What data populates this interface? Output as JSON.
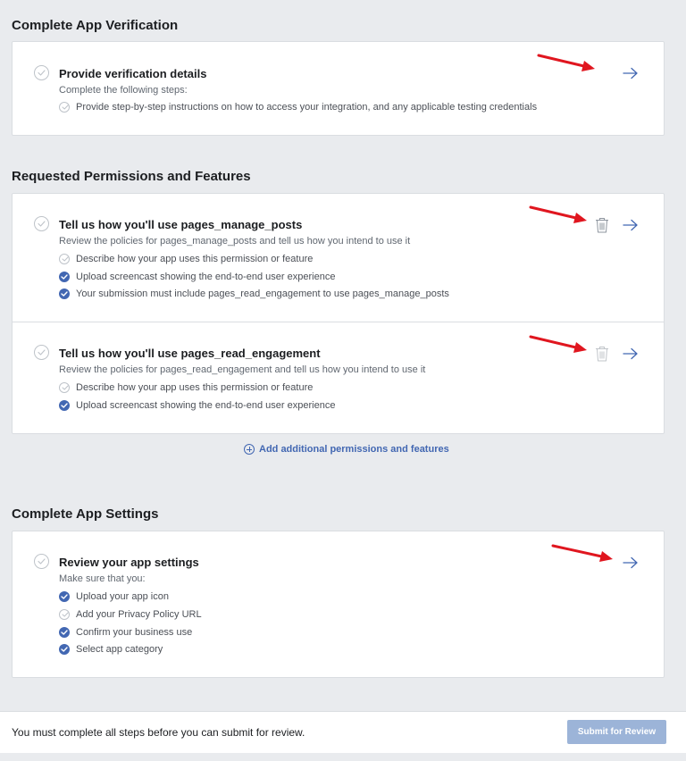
{
  "sections": {
    "verification": {
      "title": "Complete App Verification",
      "item": {
        "title": "Provide verification details",
        "subtitle": "Complete the following steps:",
        "steps": [
          {
            "text": "Provide step-by-step instructions on how to access your integration, and any applicable testing credentials",
            "done": false
          }
        ]
      }
    },
    "permissions": {
      "title": "Requested Permissions and Features",
      "items": [
        {
          "title": "Tell us how you'll use pages_manage_posts",
          "subtitle": "Review the policies for pages_manage_posts and tell us how you intend to use it",
          "steps": [
            {
              "text": "Describe how your app uses this permission or feature",
              "done": false
            },
            {
              "text": "Upload screencast showing the end-to-end user experience",
              "done": true
            },
            {
              "text": "Your submission must include pages_read_engagement to use pages_manage_posts",
              "done": true
            }
          ]
        },
        {
          "title": "Tell us how you'll use pages_read_engagement",
          "subtitle": "Review the policies for pages_read_engagement and tell us how you intend to use it",
          "steps": [
            {
              "text": "Describe how your app uses this permission or feature",
              "done": false
            },
            {
              "text": "Upload screencast showing the end-to-end user experience",
              "done": true
            }
          ]
        }
      ],
      "add_link": "Add additional permissions and features"
    },
    "settings": {
      "title": "Complete App Settings",
      "item": {
        "title": "Review your app settings",
        "subtitle": "Make sure that you:",
        "steps": [
          {
            "text": "Upload your app icon",
            "done": true
          },
          {
            "text": "Add your Privacy Policy URL",
            "done": false
          },
          {
            "text": "Confirm your business use",
            "done": true
          },
          {
            "text": "Select app category",
            "done": true
          }
        ]
      }
    }
  },
  "footer": {
    "message": "You must complete all steps before you can submit for review.",
    "submit_label": "Submit for Review"
  },
  "icons": {
    "arrow": "arrow-right-icon",
    "trash": "trash-icon",
    "check": "checkmark-icon",
    "add": "plus-circle-icon"
  },
  "colors": {
    "accent": "#4267b2",
    "annotation": "#e0161f",
    "disabled_button": "#9cb4d8"
  }
}
